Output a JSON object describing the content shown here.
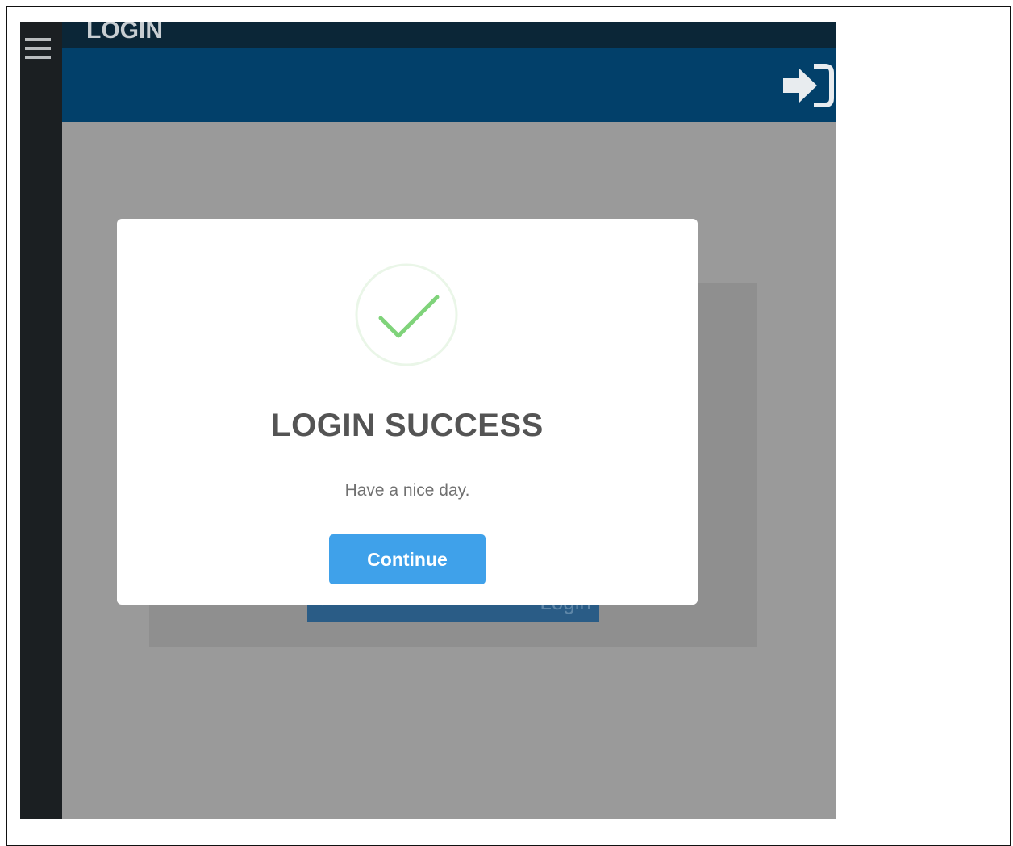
{
  "topbar": {
    "title": "LOGIN"
  },
  "background": {
    "login_button_label": "Login"
  },
  "modal": {
    "title": "LOGIN SUCCESS",
    "message": "Have a nice day.",
    "continue_label": "Continue"
  },
  "colors": {
    "header": "#02406a",
    "topbar": "#0b2637",
    "sidebar": "#1b1f22",
    "overlay": "#9a9a9a",
    "success_green": "#7fd37a",
    "primary_button": "#3fa1ea"
  },
  "icons": {
    "menu": "hamburger-icon",
    "sign_in": "sign-in-icon",
    "success": "check-icon"
  }
}
